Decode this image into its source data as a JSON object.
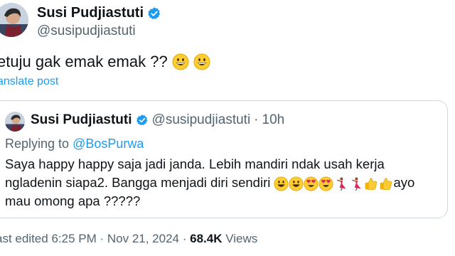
{
  "author": {
    "name": "Susi Pudjiastuti",
    "handle": "@susipudjiastuti",
    "avatar_icon": "avatar-photo",
    "verified_icon": "verified-badge-icon",
    "verified_color": "#1d9bf0"
  },
  "tweet": {
    "text": "etuju gak emak emak ??",
    "emojis": [
      "grinning-face",
      "grinning-face"
    ],
    "translate_label": "anslate post"
  },
  "quote": {
    "name": "Susi Pudjiastuti",
    "handle": "@susipudjiastuti",
    "separator": "·",
    "time": "10h",
    "reply_prefix": "Replying to ",
    "reply_mention": "@BosPurwa",
    "body_part1": "Saya happy happy saja jadi janda. Lebih mandiri ndak usah kerja ngladenin siapa2. Bangga menjadi diri sendiri",
    "emojis": [
      "grinning-face",
      "grinning-face",
      "heart-eyes-face",
      "heart-eyes-face",
      "dancer",
      "dancer",
      "thumbs-up",
      "thumbs-up"
    ],
    "body_part2": "ayo mau omong apa ?????"
  },
  "footer": {
    "edited": "ast edited 6:25 PM · Nov 21, 2024 · ",
    "views_count": "68.4K",
    "views_label": " Views"
  },
  "colors": {
    "link": "#1d9bf0",
    "muted": "#536471",
    "border": "#cfd9de",
    "text": "#0f1419"
  }
}
